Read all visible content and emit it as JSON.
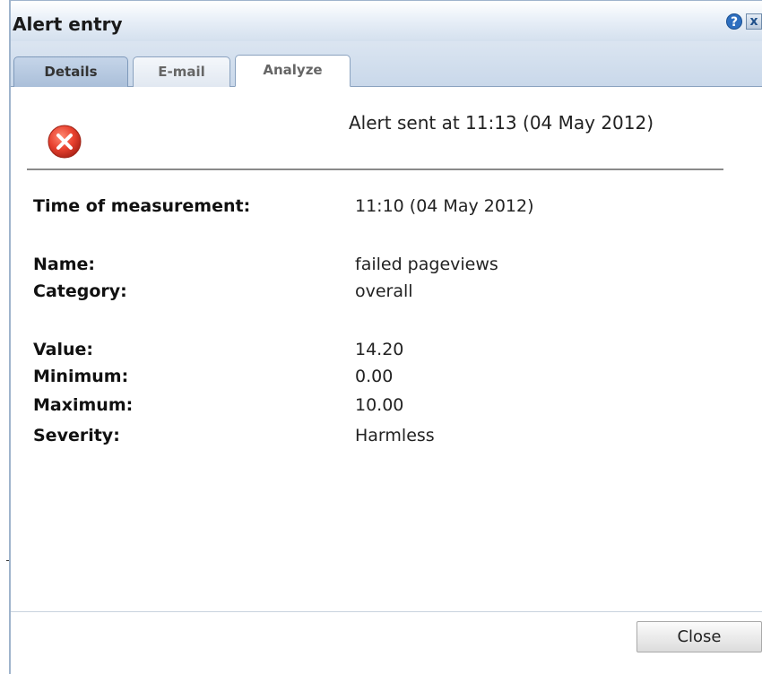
{
  "window": {
    "title": "Alert entry",
    "help_icon": "help-icon",
    "close_icon": "close-icon",
    "help_glyph": "?",
    "close_glyph": "x"
  },
  "tabs": [
    {
      "label": "Details",
      "active": true
    },
    {
      "label": "E-mail",
      "active": false
    },
    {
      "label": "Analyze",
      "active": false
    }
  ],
  "alert": {
    "status_icon": "error-icon",
    "sent_text": "Alert sent at 11:13 (04 May 2012)"
  },
  "fields": {
    "time_of_measurement": {
      "label": "Time of measurement:",
      "value": "11:10 (04 May 2012)"
    },
    "name": {
      "label": "Name:",
      "value": "failed pageviews"
    },
    "category": {
      "label": "Category:",
      "value": "overall"
    },
    "value": {
      "label": "Value:",
      "value": "14.20"
    },
    "minimum": {
      "label": "Minimum:",
      "value": "0.00"
    },
    "maximum": {
      "label": "Maximum:",
      "value": "10.00"
    },
    "severity": {
      "label": "Severity:",
      "value": "Harmless"
    }
  },
  "footer": {
    "close_label": "Close"
  },
  "colors": {
    "error_red": "#e8412f",
    "titlebar": "#d4e0ee",
    "tab_active": "#aabfd9"
  }
}
